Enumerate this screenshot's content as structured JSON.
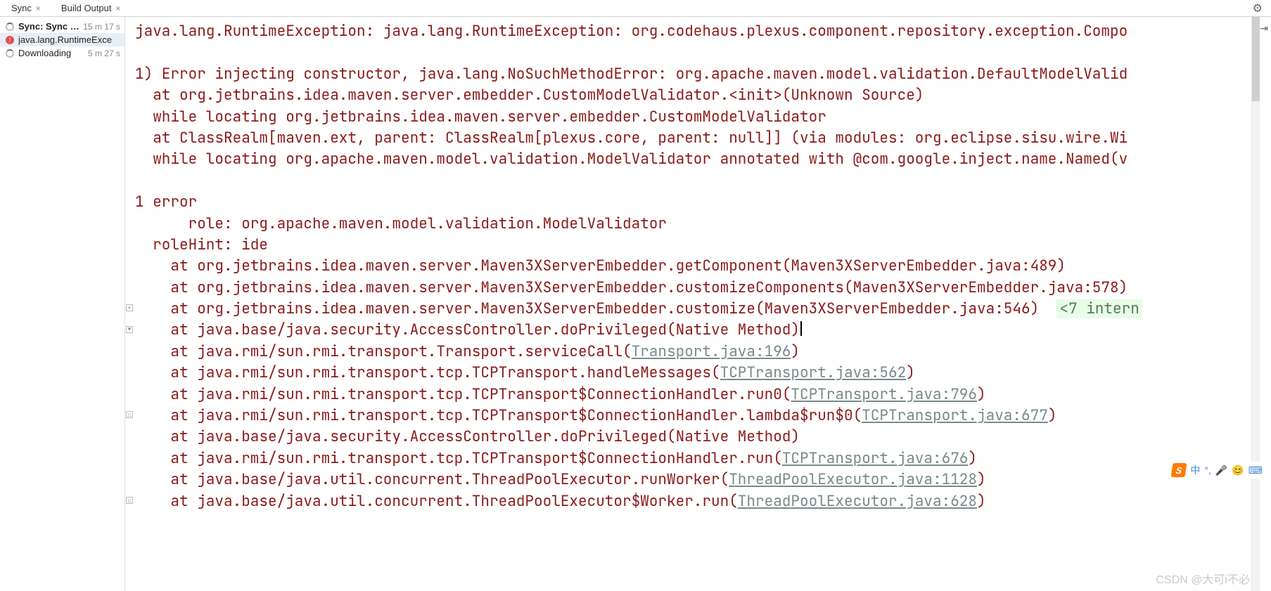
{
  "tabs": [
    {
      "label": "Sync",
      "closable": true,
      "active": false
    },
    {
      "label": "Build Output",
      "closable": true,
      "active": false
    }
  ],
  "sidebar": {
    "items": [
      {
        "icon": "spinner",
        "label": "Sync: Sync Sec",
        "time": "15 m 17 s",
        "bold": true,
        "selected": false
      },
      {
        "icon": "error",
        "label": "java.lang.RuntimeExce",
        "time": "",
        "bold": false,
        "selected": true
      },
      {
        "icon": "spinner",
        "label": "Downloading",
        "time": "5 m 27 s",
        "bold": false,
        "selected": false
      }
    ]
  },
  "gutter_marks": [
    {
      "line": 13,
      "sym": "+"
    },
    {
      "line": 14,
      "sym": "▾"
    },
    {
      "line": 18,
      "sym": "⌂"
    },
    {
      "line": 22,
      "sym": "⌂"
    }
  ],
  "editor": {
    "lines": [
      {
        "t": "java.lang.RuntimeException: java.lang.RuntimeException: org.codehaus.plexus.component.repository.exception.Compo"
      },
      {
        "t": ""
      },
      {
        "t": "1) Error injecting constructor, java.lang.NoSuchMethodError: org.apache.maven.model.validation.DefaultModelValid"
      },
      {
        "t": "  at org.jetbrains.idea.maven.server.embedder.CustomModelValidator.<init>(Unknown Source)"
      },
      {
        "t": "  while locating org.jetbrains.idea.maven.server.embedder.CustomModelValidator"
      },
      {
        "t": "  at ClassRealm[maven.ext, parent: ClassRealm[plexus.core, parent: null]] (via modules: org.eclipse.sisu.wire.Wi"
      },
      {
        "t": "  while locating org.apache.maven.model.validation.ModelValidator annotated with @com.google.inject.name.Named(v"
      },
      {
        "t": ""
      },
      {
        "t": "1 error"
      },
      {
        "t": "      role: org.apache.maven.model.validation.ModelValidator"
      },
      {
        "t": "  roleHint: ide"
      },
      {
        "t": "    at org.jetbrains.idea.maven.server.Maven3XServerEmbedder.getComponent(Maven3XServerEmbedder.java:489)"
      },
      {
        "t": "    at org.jetbrains.idea.maven.server.Maven3XServerEmbedder.customizeComponents(Maven3XServerEmbedder.java:578)"
      },
      {
        "pre": "    at org.jetbrains.idea.maven.server.Maven3XServerEmbedder.customize(Maven3XServerEmbedder.java:546)  ",
        "fold": "<7 intern"
      },
      {
        "pre": "    at java.base/java.security.AccessController.doPrivileged(Native Method)",
        "caret": true
      },
      {
        "pre": "    at java.rmi/sun.rmi.transport.Transport.serviceCall(",
        "link": "Transport.java:196",
        "post": ")"
      },
      {
        "pre": "    at java.rmi/sun.rmi.transport.tcp.TCPTransport.handleMessages(",
        "link": "TCPTransport.java:562",
        "post": ")"
      },
      {
        "pre": "    at java.rmi/sun.rmi.transport.tcp.TCPTransport$ConnectionHandler.run0(",
        "link": "TCPTransport.java:796",
        "post": ")"
      },
      {
        "pre": "    at java.rmi/sun.rmi.transport.tcp.TCPTransport$ConnectionHandler.lambda$run$0(",
        "link": "TCPTransport.java:677",
        "post": ")"
      },
      {
        "t": "    at java.base/java.security.AccessController.doPrivileged(Native Method)"
      },
      {
        "pre": "    at java.rmi/sun.rmi.transport.tcp.TCPTransport$ConnectionHandler.run(",
        "link": "TCPTransport.java:676",
        "post": ")"
      },
      {
        "pre": "    at java.base/java.util.concurrent.ThreadPoolExecutor.runWorker(",
        "link": "ThreadPoolExecutor.java:1128",
        "post": ")"
      },
      {
        "pre": "    at java.base/java.util.concurrent.ThreadPoolExecutor$Worker.run(",
        "link": "ThreadPoolExecutor.java:628",
        "post": ")"
      }
    ]
  },
  "ime": {
    "brand": "S",
    "lang": "中",
    "dots": "°,",
    "mic": "🎤",
    "emoji": "😊",
    "kbd": "⌨"
  },
  "watermark": "CSDN @大可i不必"
}
